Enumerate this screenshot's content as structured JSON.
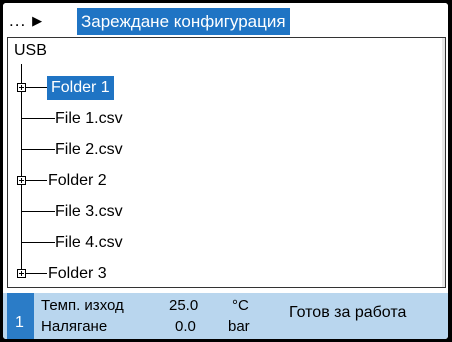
{
  "header": {
    "dots": "...",
    "arrow": "▶",
    "title": "Зареждане конфигурация"
  },
  "tree": {
    "root": "USB",
    "items": [
      {
        "label": "Folder 1",
        "type": "folder",
        "selected": true
      },
      {
        "label": "File 1.csv",
        "type": "file"
      },
      {
        "label": "File 2.csv",
        "type": "file"
      },
      {
        "label": "Folder 2",
        "type": "folder"
      },
      {
        "label": "File 3.csv",
        "type": "file"
      },
      {
        "label": "File 4.csv",
        "type": "file"
      },
      {
        "label": "Folder 3",
        "type": "folder"
      }
    ]
  },
  "status": {
    "channel": "1",
    "rows": [
      {
        "name": "Темп. изход",
        "value": "25.0",
        "unit": "°C"
      },
      {
        "name": "Налягане",
        "value": "0.0",
        "unit": "bar"
      }
    ],
    "message": "Готов за работа"
  },
  "colors": {
    "accent": "#1f74c4",
    "status_bg": "#b9d6ee",
    "channel_bg": "#2b7cc7"
  }
}
